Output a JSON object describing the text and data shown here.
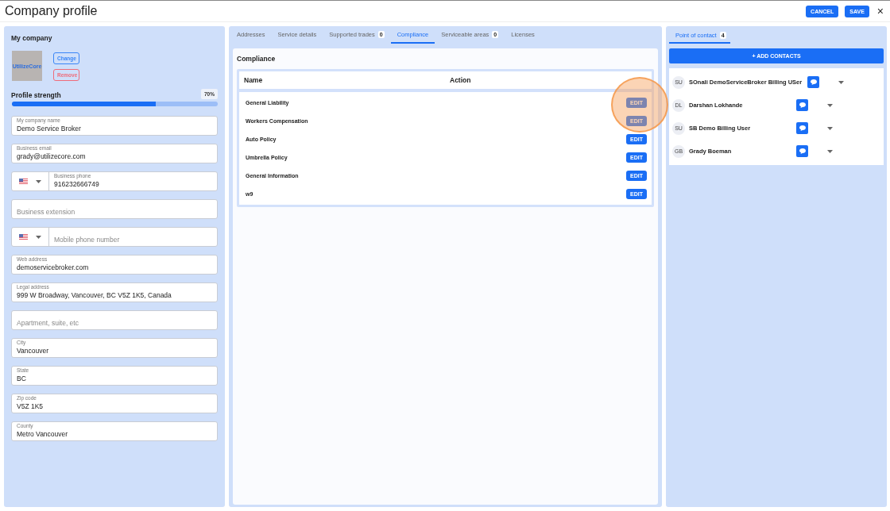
{
  "window": {
    "title": "Company profile",
    "buttons": [
      "CANCEL",
      "SAVE"
    ],
    "close": "×"
  },
  "company": {
    "title": "My company",
    "logo_text": "UtilizeCore",
    "change": "Change",
    "remove": "Remove",
    "strength_label": "Profile strength",
    "strength_reading": "70%",
    "level": 0.7,
    "fields": [
      {
        "kind": "text",
        "label": "My company name",
        "value": "Demo Service Broker"
      },
      {
        "kind": "text",
        "label": "Business email",
        "value": "grady@utilizecore.com"
      },
      {
        "kind": "phone",
        "label": "Business phone",
        "value": "916232666749"
      },
      {
        "kind": "text",
        "placeholder": "Business extension"
      },
      {
        "kind": "phone",
        "placeholder": "Mobile phone number"
      },
      {
        "kind": "text",
        "label": "Web address",
        "value": "demoservicebroker.com"
      },
      {
        "kind": "text",
        "label": "Legal address",
        "value": "999 W Broadway, Vancouver, BC V5Z 1K5, Canada"
      },
      {
        "kind": "text",
        "placeholder": "Apartment, suite, etc"
      },
      {
        "kind": "text",
        "label": "City",
        "value": "Vancouver"
      },
      {
        "kind": "text",
        "label": "State",
        "value": "BC"
      },
      {
        "kind": "text",
        "label": "Zip code",
        "value": "V5Z 1K5"
      },
      {
        "kind": "text",
        "label": "County",
        "value": "Metro Vancouver"
      }
    ]
  },
  "tabs": [
    {
      "label": "Addresses",
      "selected": false
    },
    {
      "label": "Service details",
      "selected": false
    },
    {
      "label": "Supported trades",
      "count": "0",
      "selected": false
    },
    {
      "label": "Compliance",
      "selected": true
    },
    {
      "label": "Serviceable areas",
      "count": "0",
      "selected": false
    },
    {
      "label": "Licenses",
      "selected": false
    }
  ],
  "compliance": {
    "title": "Compliance",
    "columns": [
      "Name",
      "Action"
    ],
    "rows": [
      {
        "name": "General Liability",
        "action": "EDIT"
      },
      {
        "name": "Workers Compensation",
        "action": "EDIT"
      },
      {
        "name": "Auto Policy",
        "action": "EDIT"
      },
      {
        "name": "Umbrella Policy",
        "action": "EDIT"
      },
      {
        "name": "General Information",
        "action": "EDIT"
      },
      {
        "name": "w9",
        "action": "EDIT"
      }
    ]
  },
  "contacts": {
    "tab": {
      "label": "Point of contact",
      "count": "4",
      "selected": true
    },
    "add": "+ ADD CONTACTS",
    "items": [
      {
        "initials": "SU",
        "name": "SOnali DemoServiceBroker Billing USer"
      },
      {
        "initials": "DL",
        "name": "Darshan Lokhande"
      },
      {
        "initials": "SU",
        "name": "SB Demo Billing User"
      },
      {
        "initials": "GB",
        "name": "Grady Boeman"
      }
    ]
  }
}
